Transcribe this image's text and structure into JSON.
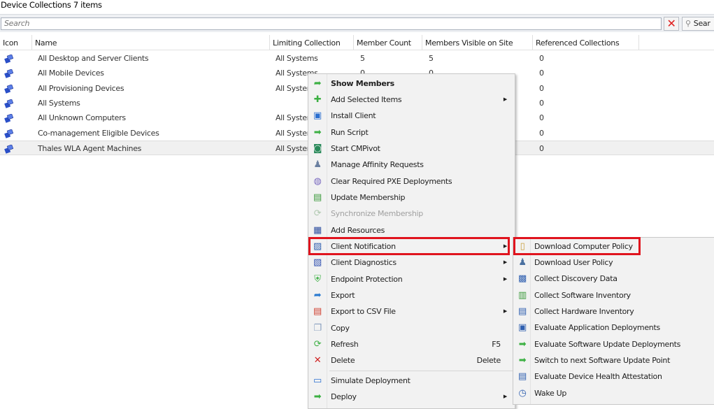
{
  "title": "Device Collections 7 items",
  "search": {
    "placeholder": "Search",
    "clear_icon": "x-icon",
    "button_label": "Sear"
  },
  "columns": [
    "Icon",
    "Name",
    "Limiting Collection",
    "Member Count",
    "Members Visible on Site",
    "Referenced Collections"
  ],
  "rows": [
    {
      "name": "All Desktop and Server Clients",
      "limiting": "All Systems",
      "member_count": "5",
      "visible": "5",
      "referenced": "0"
    },
    {
      "name": "All Mobile Devices",
      "limiting": "All Systems",
      "member_count": "0",
      "visible": "0",
      "referenced": "0"
    },
    {
      "name": "All Provisioning Devices",
      "limiting": "All Systems",
      "member_count": "",
      "visible": "",
      "referenced": "0"
    },
    {
      "name": "All Systems",
      "limiting": "",
      "member_count": "",
      "visible": "",
      "referenced": "0"
    },
    {
      "name": "All Unknown Computers",
      "limiting": "All Systems",
      "member_count": "",
      "visible": "",
      "referenced": "0"
    },
    {
      "name": "Co-management Eligible Devices",
      "limiting": "All Systems",
      "member_count": "",
      "visible": "",
      "referenced": "0"
    },
    {
      "name": "Thales WLA Agent Machines",
      "limiting": "All Systems",
      "member_count": "",
      "visible": "",
      "referenced": "0",
      "selected": true
    }
  ],
  "context_menu": [
    {
      "label": "Show Members",
      "icon": "arrow-right-curved-icon",
      "bold": true
    },
    {
      "label": "Add Selected Items",
      "icon": "plus-icon",
      "submenu": true
    },
    {
      "label": "Install Client",
      "icon": "install-client-icon"
    },
    {
      "label": "Run Script",
      "icon": "arrow-right-icon"
    },
    {
      "label": "Start CMPivot",
      "icon": "cmpivot-icon"
    },
    {
      "label": "Manage Affinity Requests",
      "icon": "affinity-icon"
    },
    {
      "label": "Clear Required PXE Deployments",
      "icon": "pxe-icon"
    },
    {
      "label": "Update Membership",
      "icon": "update-membership-icon"
    },
    {
      "label": "Synchronize Membership",
      "icon": "sync-icon",
      "disabled": true
    },
    {
      "label": "Add Resources",
      "icon": "add-resources-icon"
    },
    {
      "label": "Client Notification",
      "icon": "client-notification-icon",
      "submenu": true,
      "highlighted": true
    },
    {
      "label": "Client Diagnostics",
      "icon": "client-diagnostics-icon",
      "submenu": true
    },
    {
      "label": "Endpoint Protection",
      "icon": "shield-icon",
      "submenu": true
    },
    {
      "label": "Export",
      "icon": "export-icon"
    },
    {
      "label": "Export to CSV File",
      "icon": "csv-icon",
      "submenu": true
    },
    {
      "label": "Copy",
      "icon": "copy-icon"
    },
    {
      "label": "Refresh",
      "icon": "refresh-icon",
      "shortcut": "F5"
    },
    {
      "label": "Delete",
      "icon": "delete-icon",
      "shortcut": "Delete"
    },
    {
      "separator": true
    },
    {
      "label": "Simulate Deployment",
      "icon": "window-icon"
    },
    {
      "label": "Deploy",
      "icon": "arrow-right-icon",
      "submenu": true
    }
  ],
  "submenu": [
    {
      "label": "Download Computer Policy",
      "icon": "policy-icon",
      "highlighted": true
    },
    {
      "label": "Download User Policy",
      "icon": "user-icon"
    },
    {
      "label": "Collect Discovery Data",
      "icon": "discovery-icon"
    },
    {
      "label": "Collect Software Inventory",
      "icon": "software-inventory-icon"
    },
    {
      "label": "Collect Hardware Inventory",
      "icon": "hardware-inventory-icon"
    },
    {
      "label": "Evaluate Application Deployments",
      "icon": "app-deploy-icon"
    },
    {
      "label": "Evaluate Software Update Deployments",
      "icon": "update-deploy-icon"
    },
    {
      "label": "Switch to next Software Update Point",
      "icon": "switch-sup-icon"
    },
    {
      "label": "Evaluate Device Health Attestation",
      "icon": "health-icon"
    },
    {
      "label": "Wake Up",
      "icon": "clock-icon"
    }
  ],
  "colors": {
    "highlight_border": "#e0141e",
    "menu_bg": "#f2f2f2",
    "icon_blue": "#2a4fc8",
    "icon_green": "#3cb043"
  }
}
